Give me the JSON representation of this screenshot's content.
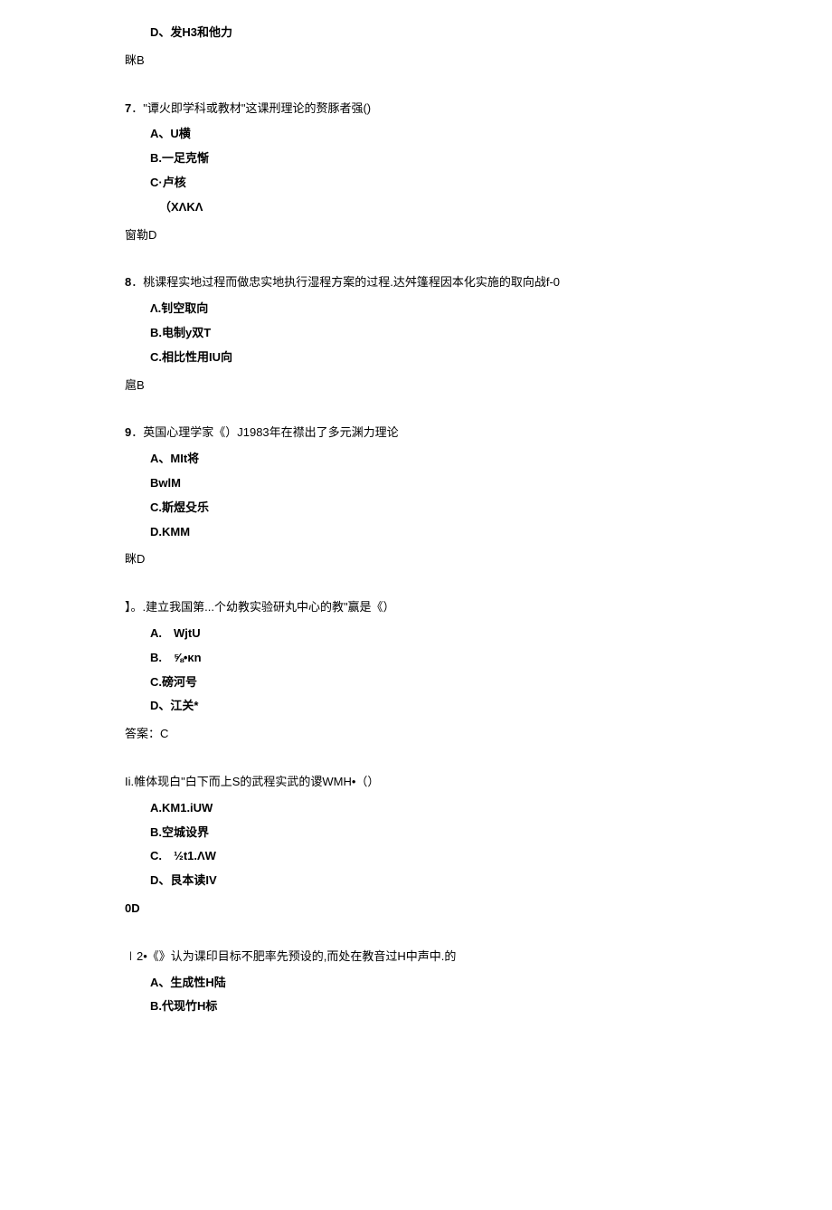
{
  "q6_option_d": "D、发H3和他力",
  "q6_answer": "眯B",
  "q7_stem_num": "7",
  "q7_stem_text": "．\"谭火即学科或教材\"这课刑理论的赘豚者强()",
  "q7_opt_a": "A、U横",
  "q7_opt_b": "B.一足克惭",
  "q7_opt_c": "C·卢核",
  "q7_opt_d": "（XΛKΛ",
  "q7_answer": "窗勒D",
  "q8_stem_num": "8",
  "q8_stem_text": "．桃课程实地过程而做忠实地执行湿程方案的过程.达舛篷程因本化实施的取向战f-0",
  "q8_opt_a": "Λ.钊空取向",
  "q8_opt_b": "B.电制y双T",
  "q8_opt_c": "C.相比性用IU向",
  "q8_answer": "扈B",
  "q9_stem_num": "9",
  "q9_stem_text": "．英国心理学家《）J1983年在襟出了多元渊力理论",
  "q9_opt_a": "A、MIt将",
  "q9_opt_b": "BwlM",
  "q9_opt_c": "C.斯煜殳乐",
  "q9_opt_d": "D.KMM",
  "q9_answer": "眯D",
  "q10_stem": "】。.建立我国第...个幼教实验研丸中心的教\"赢是《）",
  "q10_opt_a": "A.　WjtU",
  "q10_opt_b": "B.　⅝•κn",
  "q10_opt_c": "C.磅河号",
  "q10_opt_d": "D、江关*",
  "q10_answer": "答案：C",
  "q11_stem": "Ii.帷体现白\"白下而上S的武程实武的谡WMH•（）",
  "q11_opt_a": "A.KM1.iUW",
  "q11_opt_b": "B.空城设界",
  "q11_opt_c": "C.　½t1.ΛW",
  "q11_opt_d": "D、艮本读IV",
  "q11_answer": "0D",
  "q12_stem": "∣2•《》认为课印目标不肥率先预设的,而处在教音过H中声中.的",
  "q12_opt_a": "A、生成性H陆",
  "q12_opt_b": "B.代现竹H标"
}
